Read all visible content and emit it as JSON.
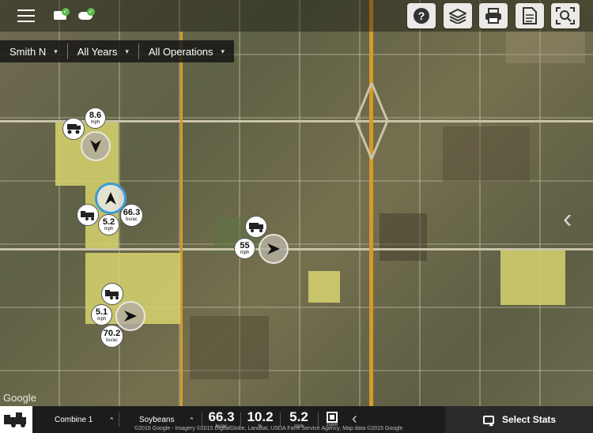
{
  "header": {
    "menu_icon": "hamburger-icon",
    "status_icons": [
      "device-sync-icon",
      "cloud-sync-icon"
    ],
    "actions": [
      {
        "name": "help-icon",
        "glyph": "?"
      },
      {
        "name": "layers-icon",
        "glyph": "≋"
      },
      {
        "name": "print-icon",
        "glyph": "⎙"
      },
      {
        "name": "report-icon",
        "glyph": "▤"
      },
      {
        "name": "map-search-icon",
        "glyph": "⌕"
      }
    ]
  },
  "filters": {
    "farm": "Smith N",
    "years": "All Years",
    "operations": "All Operations"
  },
  "machines": [
    {
      "kind": "combine",
      "speed": "5.2",
      "speed_unit": "mph",
      "yield": "66.3",
      "yield_unit": "bu/ac",
      "arrow": "up",
      "active": true
    },
    {
      "kind": "grain-cart",
      "speed": "8.6",
      "speed_unit": "mph",
      "arrow": "down",
      "active": false
    },
    {
      "kind": "truck",
      "speed": "55",
      "speed_unit": "mph",
      "arrow": "right",
      "active": false
    },
    {
      "kind": "combine",
      "speed": "5.1",
      "speed_unit": "mph",
      "yield": "70.2",
      "yield_unit": "bu/ac",
      "arrow": "right",
      "active": false
    }
  ],
  "map": {
    "google_logo": "Google",
    "attribution": "©2015 Google - Imagery ©2015 DigitalGlobe, Landsat, USDA Farm Service Agency, Map data ©2015 Google",
    "side_nav_icon": "chevron-left-icon"
  },
  "bottom_bar": {
    "machine_label": "Combine 1",
    "crop_label": "Soybeans",
    "stats": [
      {
        "value": "66.3",
        "unit": "bu/ac"
      },
      {
        "value": "10.2",
        "unit": "%"
      },
      {
        "value": "5.2",
        "unit": "mph"
      }
    ],
    "zoom_label": "zoom",
    "select_stats_label": "Select Stats"
  },
  "colors": {
    "accent": "#3b9bd6",
    "highlight_field": "#d8d66a",
    "highway": "#d79a2a"
  }
}
